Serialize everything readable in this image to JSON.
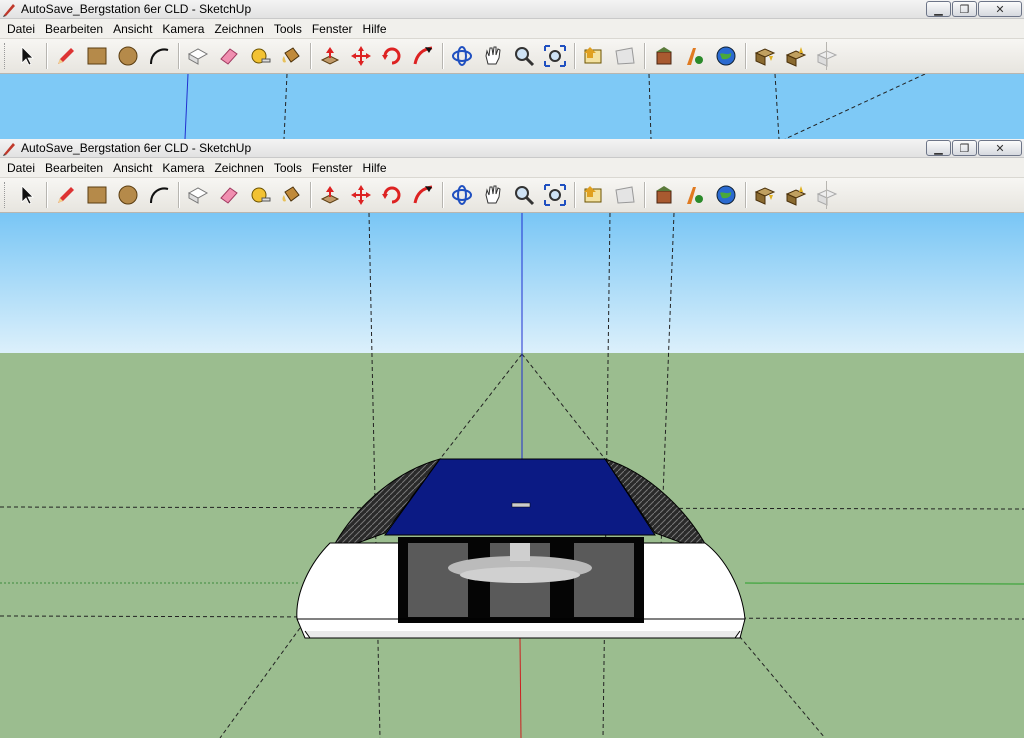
{
  "windows": {
    "back": {
      "title": "AutoSave_Bergstation 6er CLD - SketchUp"
    },
    "front": {
      "title": "AutoSave_Bergstation 6er CLD - SketchUp"
    }
  },
  "window_controls": {
    "minimize": "▁",
    "maximize": "❐",
    "close": "✕"
  },
  "menu": [
    "Datei",
    "Bearbeiten",
    "Ansicht",
    "Kamera",
    "Zeichnen",
    "Tools",
    "Fenster",
    "Hilfe"
  ],
  "toolbar": {
    "groups": [
      [
        "select-icon"
      ],
      [
        "line-pencil-icon",
        "rectangle-icon",
        "circle-icon",
        "arc-icon"
      ],
      [
        "make-component-icon",
        "eraser-icon",
        "tape-measure-icon",
        "paint-bucket-icon"
      ],
      [
        "push-pull-icon",
        "move-icon",
        "rotate-icon",
        "follow-me-icon"
      ],
      [
        "orbit-icon",
        "pan-hand-icon",
        "zoom-icon",
        "zoom-extents-icon"
      ],
      [
        "previous-view-icon",
        "next-view-icon"
      ],
      [
        "add-location-icon",
        "toggle-terrain-icon",
        "google-earth-icon"
      ],
      [
        "get-models-icon",
        "share-model-icon",
        "share-component-icon"
      ]
    ]
  },
  "colors": {
    "sky_top": "#79c6f5",
    "sky_horizon": "#d8eefa",
    "ground": "#9bbd8f",
    "roof_blue": "#0b1a84",
    "axis_blue": "#2030d0",
    "axis_red": "#cc2020",
    "axis_green": "#2aa02a",
    "hull_white": "#ffffff",
    "window_black": "#050505",
    "window_gray": "#5a5a5a"
  }
}
